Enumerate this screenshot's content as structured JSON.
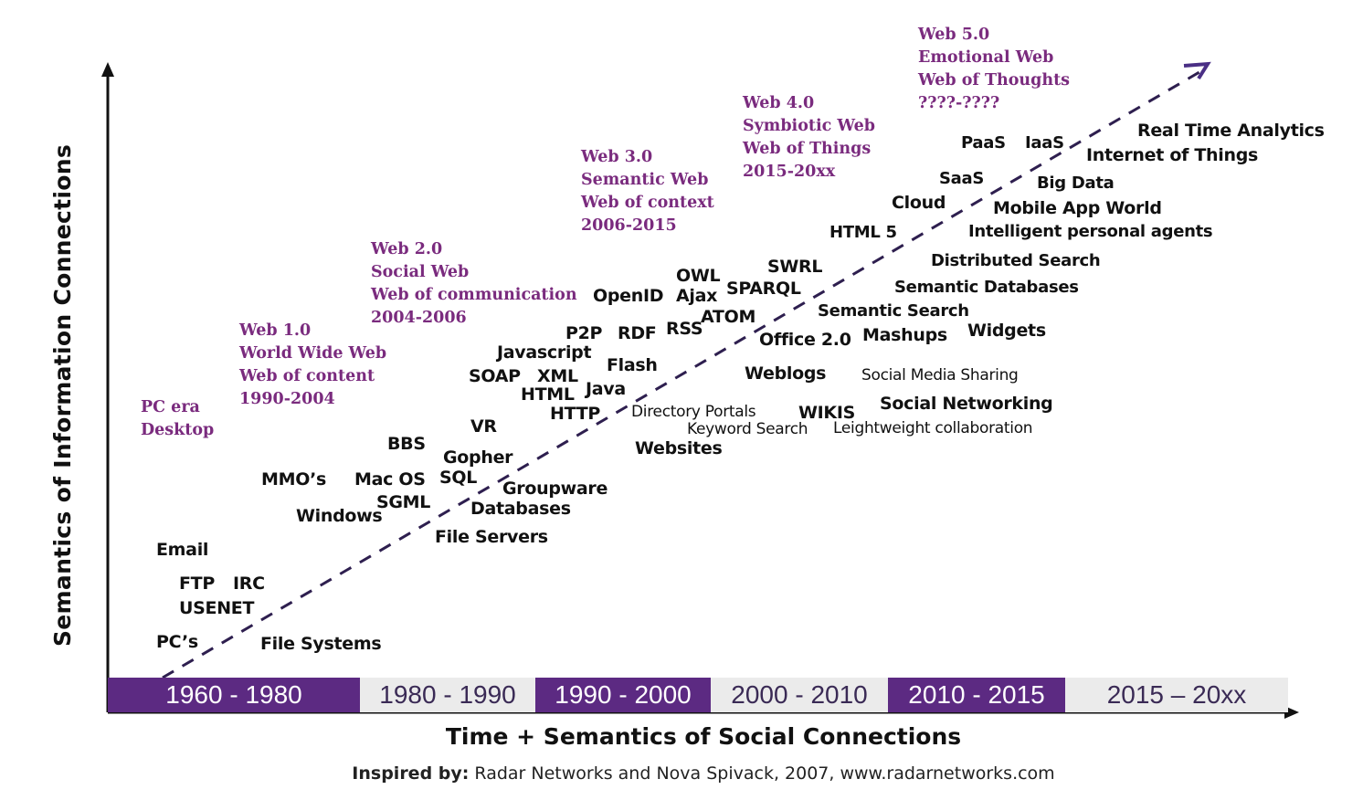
{
  "diagram": {
    "y_axis_title": "Semantics of Information  Connections",
    "x_axis_title": "Time + Semantics of Social Connections",
    "credit": {
      "prefix": "Inspired by:",
      "text": " Radar Networks  and Nova Spivack, 2007,  www.radarnetworks.com"
    },
    "colors": {
      "era_text": "#7a2b7e",
      "band_dark": "#5c2a82",
      "band_light": "#ebebeb",
      "trend_line": "#2e1f4f"
    },
    "time_bands": [
      {
        "label": "1960 - 1980",
        "style": "dark"
      },
      {
        "label": "1980 - 1990",
        "style": "light"
      },
      {
        "label": "1990 - 2000",
        "style": "dark"
      },
      {
        "label": "2000 - 2010",
        "style": "light"
      },
      {
        "label": "2010 - 2015",
        "style": "dark"
      },
      {
        "label": "2015 – 20xx",
        "style": "light"
      }
    ],
    "eras": [
      {
        "lines": [
          "PC era",
          "Desktop"
        ]
      },
      {
        "lines": [
          "Web 1.0",
          "World Wide Web",
          "Web of content",
          "1990-2004"
        ]
      },
      {
        "lines": [
          "Web 2.0",
          "Social Web",
          "Web of communication",
          "2004-2006"
        ]
      },
      {
        "lines": [
          "Web 3.0",
          "Semantic Web",
          "Web of context",
          "2006-2015"
        ]
      },
      {
        "lines": [
          "Web 4.0",
          "Symbiotic Web",
          "Web of Things",
          "2015-20xx"
        ]
      },
      {
        "lines": [
          "Web 5.0",
          "Emotional Web",
          "Web of Thoughts",
          "????-????"
        ]
      }
    ],
    "technologies": {
      "pcs": "PC’s",
      "file_systems": "File Systems",
      "usenet": "USENET",
      "ftp": "FTP",
      "irc": "IRC",
      "email": "Email",
      "windows": "Windows",
      "sgml": "SGML",
      "file_servers": "File Servers",
      "databases": "Databases",
      "groupware": "Groupware",
      "mmos": "MMO’s",
      "mac_os": "Mac OS",
      "sql": "SQL",
      "gopher": "Gopher",
      "bbs": "BBS",
      "vr": "VR",
      "http": "HTTP",
      "html": "HTML",
      "java": "Java",
      "soap": "SOAP",
      "xml": "XML",
      "javascript": "Javascript",
      "flash": "Flash",
      "p2p": "P2P",
      "rdf": "RDF",
      "rss": "RSS",
      "openid": "OpenID",
      "ajax": "Ajax",
      "owl": "OWL",
      "sparql": "SPARQL",
      "atom": "ATOM",
      "swrl": "SWRL",
      "websites": "Websites",
      "directory_portals": "Directory Portals",
      "keyword_search": "Keyword Search",
      "wikis": "WIKIS",
      "weblogs": "Weblogs",
      "office_2": "Office 2.0",
      "mashups": "Mashups",
      "semantic_search": "Semantic Search",
      "widgets": "Widgets",
      "semantic_databases": "Semantic Databases",
      "distributed_search": "Distributed Search",
      "social_media_sharing": "Social Media Sharing",
      "social_networking": "Social Networking",
      "lightweight_collab": "Leightweight collaboration",
      "html5": "HTML 5",
      "cloud": "Cloud",
      "saas": "SaaS",
      "paas": "PaaS",
      "iaas": "IaaS",
      "intelligent_agents": "Intelligent personal agents",
      "mobile_app_world": "Mobile App World",
      "big_data": "Big Data",
      "internet_of_things": "Internet of Things",
      "real_time_analytics": "Real Time Analytics"
    }
  }
}
